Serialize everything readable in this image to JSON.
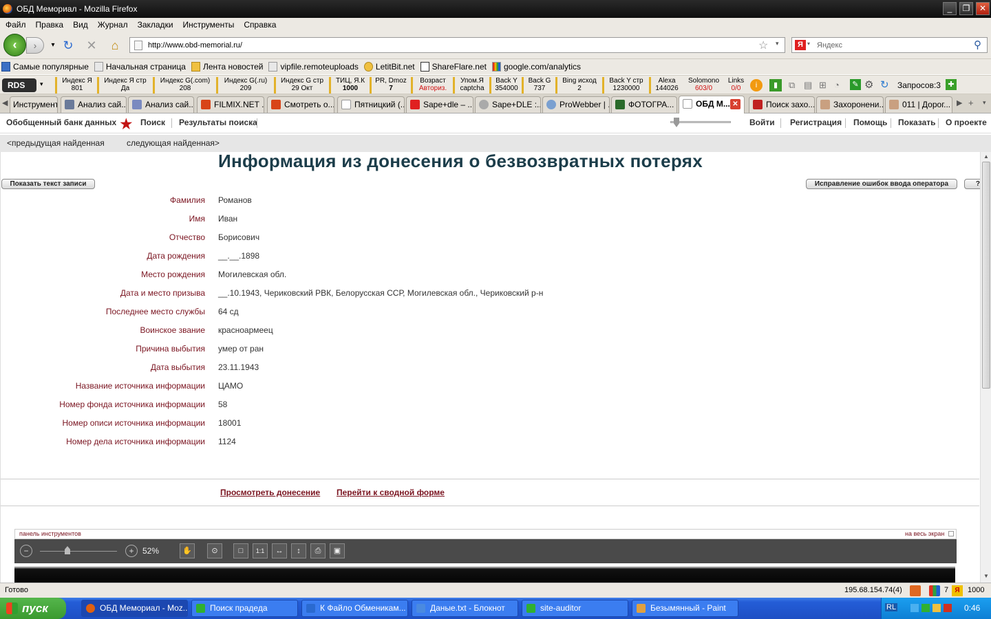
{
  "window": {
    "title": "ОБД Мемориал - Mozilla Firefox"
  },
  "menu": [
    "Файл",
    "Правка",
    "Вид",
    "Журнал",
    "Закладки",
    "Инструменты",
    "Справка"
  ],
  "nav": {
    "url": "http://www.obd-memorial.ru/",
    "search_placeholder": "Яндекс"
  },
  "bookmarks": [
    "Самые популярные",
    "Начальная страница",
    "Лента новостей",
    "vipfile.remoteuploads",
    "LetitBit.net",
    "ShareFlare.net",
    "google.com/analytics"
  ],
  "rds": {
    "logo": "RDS",
    "cells": [
      {
        "label": "Индекс Я",
        "value": "801"
      },
      {
        "label": "Индекс Я стр",
        "value": "Да"
      },
      {
        "label": "Индекс G(.com)",
        "value": "208"
      },
      {
        "label": "Индекс G(.ru)",
        "value": "209"
      },
      {
        "label": "Индекс G стр",
        "value": "29 Окт"
      },
      {
        "label": "ТИЦ, Я.К",
        "value": "1000"
      },
      {
        "label": "PR, Dmoz",
        "value": "7"
      },
      {
        "label": "Возраст",
        "value": "Авториз."
      },
      {
        "label": "Упом.Я",
        "value": "captcha"
      },
      {
        "label": "Back Y",
        "value": "354000"
      },
      {
        "label": "Back G",
        "value": "737"
      },
      {
        "label": "Bing исход",
        "value": "2"
      },
      {
        "label": "Back Y стр",
        "value": "1230000"
      },
      {
        "label": "Alexa",
        "value": "144026"
      },
      {
        "label": "Solomono",
        "value": "603/0"
      },
      {
        "label": "Links",
        "value": "0/0"
      }
    ],
    "requests": "Запросов:3"
  },
  "tabs": [
    "Инструмент...",
    "Анализ сай...",
    "Анализ сай...",
    "FILMIX.NET ...",
    "Смотреть о...",
    "Пятницкий (...",
    "Sape+dle – ...",
    "Sape+DLE :...",
    "ProWebber | ...",
    "ФОТОГРА...",
    "ОБД М...",
    "Поиск захо...",
    "Захоронени...",
    "011 | Дорог..."
  ],
  "site": {
    "nav_left": [
      "Обобщенный банк данных",
      "Поиск",
      "Результаты поиска"
    ],
    "nav_right": [
      "Войти",
      "Регистрация",
      "Помощь",
      "Показать",
      "О проекте"
    ],
    "prev": "<предыдущая найденная",
    "next": "следующая найденная>",
    "heading": "Информация из донесения о безвозвратных потерях",
    "show_text_btn": "Показать текст записи",
    "fix_btn": "Исправление ошибок ввода оператора",
    "help_btn": "?",
    "fields": [
      {
        "label": "Фамилия",
        "value": "Романов"
      },
      {
        "label": "Имя",
        "value": "Иван"
      },
      {
        "label": "Отчество",
        "value": "Борисович"
      },
      {
        "label": "Дата рождения",
        "value": "__.__.1898"
      },
      {
        "label": "Место рождения",
        "value": "Могилевская обл."
      },
      {
        "label": "Дата и место призыва",
        "value": "__.10.1943, Чериковский РВК, Белорусская ССР, Могилевская обл., Чериковский р-н"
      },
      {
        "label": "Последнее место службы",
        "value": "64 сд"
      },
      {
        "label": "Воинское звание",
        "value": "красноармеец"
      },
      {
        "label": "Причина выбытия",
        "value": "умер от ран"
      },
      {
        "label": "Дата выбытия",
        "value": "23.11.1943"
      },
      {
        "label": "Название источника информации",
        "value": "ЦАМО"
      },
      {
        "label": "Номер фонда источника информации",
        "value": "58"
      },
      {
        "label": "Номер описи источника информации",
        "value": "18001"
      },
      {
        "label": "Номер дела источника информации",
        "value": "1124"
      }
    ],
    "link_report": "Просмотреть донесение",
    "link_summary": "Перейти к сводной форме",
    "viewer": {
      "panel_label": "панель инструментов",
      "fullscreen": "на весь экран",
      "zoom": "52%"
    }
  },
  "status": {
    "text": "Готово",
    "ip": "195.68.154.74(4)",
    "count1": "7",
    "count2": "1000"
  },
  "taskbar": {
    "start": "пуск",
    "tasks": [
      "ОБД Мемориал - Moz...",
      "Поиск прадеда",
      "К Файло Обменикам...",
      "Даные.txt - Блокнот",
      "site-auditor",
      "Безымянный - Paint"
    ],
    "lang": "RL",
    "time": "0:46"
  }
}
